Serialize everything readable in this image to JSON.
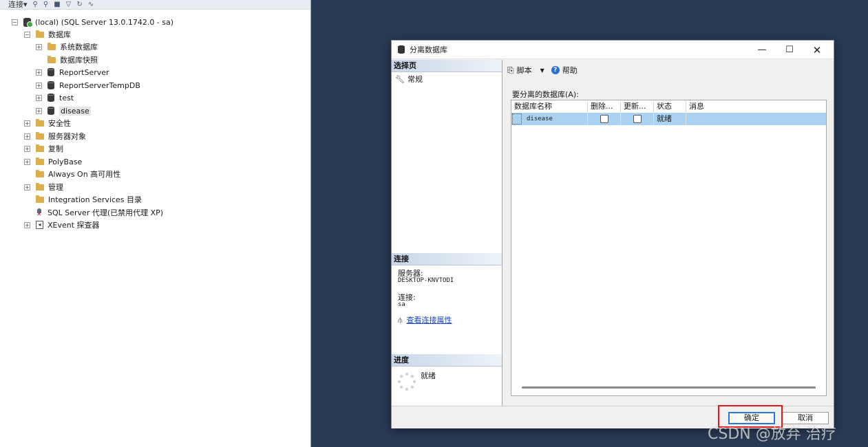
{
  "object_explorer": {
    "toolbar": {
      "connect_label": "连接▾"
    },
    "tree": [
      {
        "label": "(local) (SQL Server 13.0.1742.0 - sa)"
      },
      {
        "label": "数据库"
      },
      {
        "label": "系统数据库"
      },
      {
        "label": "数据库快照"
      },
      {
        "label": "ReportServer"
      },
      {
        "label": "ReportServerTempDB"
      },
      {
        "label": "test"
      },
      {
        "label": "disease"
      },
      {
        "label": "安全性"
      },
      {
        "label": "服务器对象"
      },
      {
        "label": "复制"
      },
      {
        "label": "PolyBase"
      },
      {
        "label": "Always On 高可用性"
      },
      {
        "label": "管理"
      },
      {
        "label": "Integration Services 目录"
      },
      {
        "label": "SQL Server 代理(已禁用代理 XP)"
      },
      {
        "label": "XEvent 探查器"
      }
    ]
  },
  "dialog": {
    "title": "分离数据库",
    "select_page": {
      "header": "选择页",
      "items": [
        {
          "label": "常规"
        }
      ]
    },
    "connection": {
      "header": "连接",
      "server_label": "服务器:",
      "server_value": "DESKTOP-KNVTODI",
      "conn_label": "连接:",
      "conn_value": "sa",
      "view_link": "查看连接属性"
    },
    "progress": {
      "header": "进度",
      "status": "就绪"
    },
    "toolbar": {
      "script_label": "脚本",
      "help_label": "帮助"
    },
    "grid": {
      "caption": "要分离的数据库(A):",
      "columns": [
        "数据库名称",
        "删除...",
        "更新...",
        "状态",
        "消息"
      ],
      "rows": [
        {
          "name": "disease",
          "drop": false,
          "update": false,
          "status": "就绪",
          "message": ""
        }
      ]
    },
    "buttons": {
      "ok": "确定",
      "cancel": "取消"
    }
  },
  "watermark": "CSDN @放弃        治疗"
}
